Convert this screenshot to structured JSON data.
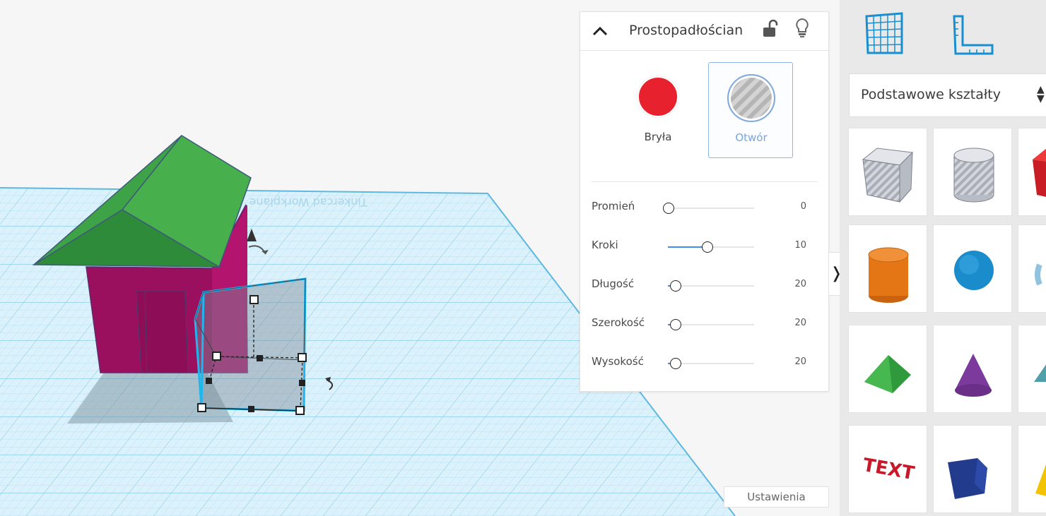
{
  "inspector": {
    "title": "Prostopadłościan",
    "solid_label": "Bryła",
    "hole_label": "Otwór",
    "selected_type": "hole",
    "solid_color": "#e8212f",
    "params": [
      {
        "label": "Promień",
        "value": "0",
        "fraction": 0.0
      },
      {
        "label": "Kroki",
        "value": "10",
        "fraction": 0.45
      },
      {
        "label": "Długość",
        "value": "20",
        "fraction": 0.08
      },
      {
        "label": "Szerokość",
        "value": "20",
        "fraction": 0.08
      },
      {
        "label": "Wysokość",
        "value": "20",
        "fraction": 0.08
      }
    ]
  },
  "settings_label": "Ustawienia",
  "expand_glyph": "❭",
  "shapes_panel": {
    "category": "Podstawowe kształty",
    "tiles": [
      {
        "name": "box-hole",
        "color": "#c0c4cc"
      },
      {
        "name": "cylinder-hole",
        "color": "#c0c4cc"
      },
      {
        "name": "box",
        "color": "#d9202a"
      },
      {
        "name": "cylinder",
        "color": "#e8761c"
      },
      {
        "name": "sphere",
        "color": "#1e90cf"
      },
      {
        "name": "scribble",
        "color": "#7fb6d9"
      },
      {
        "name": "roof",
        "color": "#2f9c3d"
      },
      {
        "name": "cone",
        "color": "#7c3b9c"
      },
      {
        "name": "round-roof",
        "color": "#4fa0a8"
      },
      {
        "name": "text",
        "color": "#c7192a"
      },
      {
        "name": "polygon",
        "color": "#233b8c"
      },
      {
        "name": "pyramid",
        "color": "#f2c400"
      }
    ]
  },
  "scene": {
    "house_wall_color": "#9a0f5e",
    "roof_color": "#3faa45",
    "grid_color": "#8fd0ec",
    "selection_color": "#1fb6ef"
  }
}
